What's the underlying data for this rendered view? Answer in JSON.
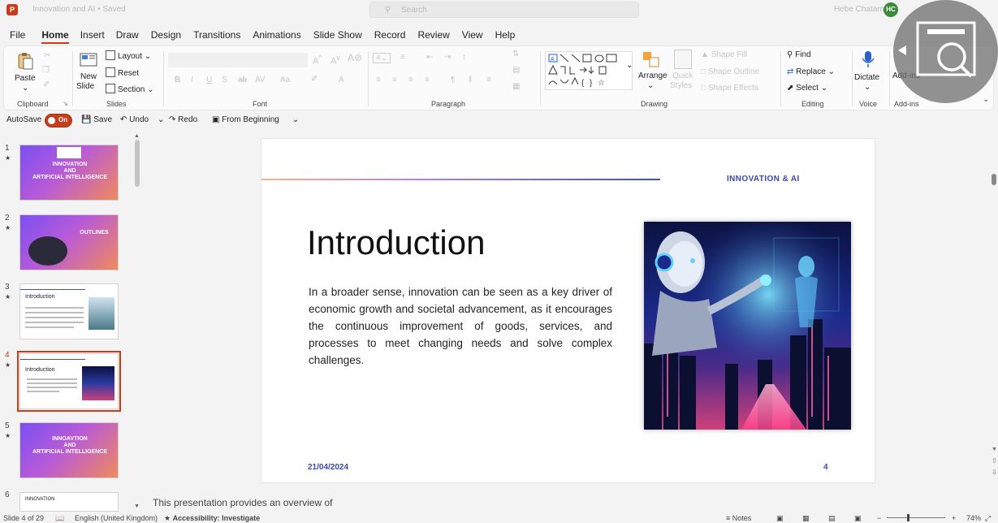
{
  "titlebar": {
    "app_icon_letter": "P",
    "doc_title": "Innovation and AI  •  Saved",
    "search_placeholder": "Search",
    "user_name": "Hebe Chatam",
    "user_initials": "HC"
  },
  "tabs": [
    "File",
    "Home",
    "Insert",
    "Draw",
    "Design",
    "Transitions",
    "Animations",
    "Slide Show",
    "Record",
    "Review",
    "View",
    "Help"
  ],
  "active_tab": "Home",
  "ribbon": {
    "clipboard": {
      "label": "Clipboard",
      "paste": "Paste"
    },
    "slides": {
      "label": "Slides",
      "new_slide": "New",
      "new_slide2": "Slide",
      "layout": "Layout",
      "reset": "Reset",
      "section": "Section"
    },
    "font": {
      "label": "Font"
    },
    "paragraph": {
      "label": "Paragraph"
    },
    "drawing": {
      "label": "Drawing",
      "arrange": "Arrange",
      "quick_styles": "Quick",
      "quick_styles2": "Styles",
      "shape_fill": "Shape Fill",
      "shape_outline": "Shape Outline",
      "shape_effects": "Shape Effects"
    },
    "editing": {
      "label": "Editing",
      "find": "Find",
      "replace": "Replace",
      "select": "Select"
    },
    "voice": {
      "label": "Voice",
      "dictate": "Dictate"
    },
    "addins": {
      "label": "Add-ins",
      "addins": "Add-ins"
    }
  },
  "qat": {
    "autosave": "AutoSave",
    "toggle": "On",
    "save": "Save",
    "undo": "Undo",
    "redo": "Redo",
    "from_beginning": "From Beginning"
  },
  "thumbnails": [
    {
      "num": "1",
      "title": "INNOVATION\nAND\nARTIFICIAL INTELLIGENCE"
    },
    {
      "num": "2",
      "title": "OUTLINES"
    },
    {
      "num": "3",
      "title": "Introduction"
    },
    {
      "num": "4",
      "title": "Introduction"
    },
    {
      "num": "5",
      "title": "INNOAVTION\nAND\nARTIFICIAL INTELLIGENCE"
    },
    {
      "num": "6",
      "title": "INNOVATION"
    }
  ],
  "slide": {
    "header": "INNOVATION & AI",
    "title": "Introduction",
    "body": "In a broader sense, innovation can be seen as a key driver of economic growth and societal advancement, as it encourages the continuous improvement of goods, services, and processes to meet changing needs and solve complex challenges.",
    "date": "21/04/2024",
    "number": "4"
  },
  "notes": "This presentation provides an overview of",
  "statusbar": {
    "slide_count": "Slide 4 of 29",
    "language": "English (United Kingdom)",
    "accessibility": "Accessibility: Investigate",
    "notes": "Notes",
    "zoom": "74%"
  },
  "colors": {
    "accent": "#c43e1c",
    "slide_blue": "#3949ab"
  }
}
